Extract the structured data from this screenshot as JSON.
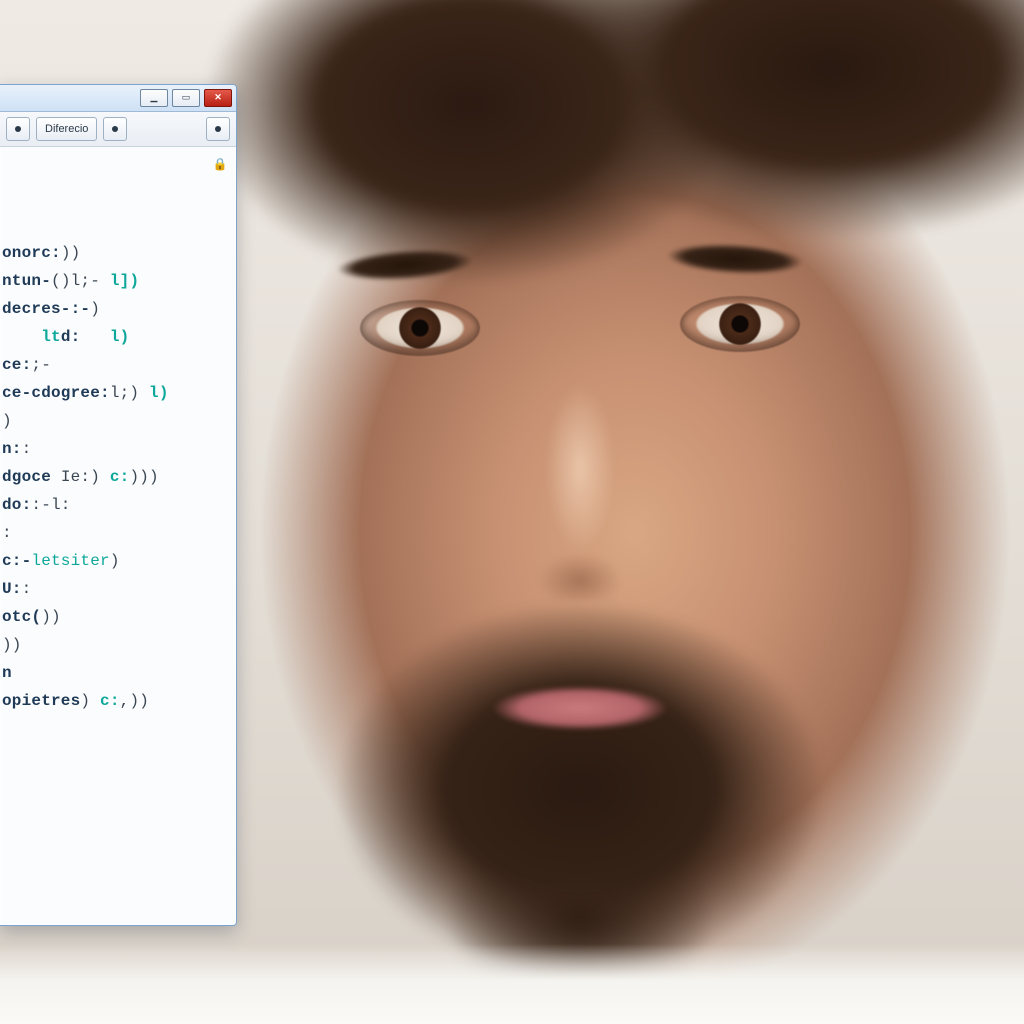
{
  "window": {
    "btn_min_glyph": "▁",
    "btn_max_glyph": "▭",
    "btn_close_glyph": "✕"
  },
  "toolbar": {
    "left_icon_glyph": "●",
    "tab_label": "Diferecio",
    "mid_icon_glyph": "●",
    "right_icon_glyph": "●"
  },
  "editor": {
    "lock_glyph": "🔒",
    "lines": [
      {
        "segments": [
          {
            "t": "onorc:",
            "c": "kw"
          },
          {
            "t": "))",
            "c": "punc"
          }
        ]
      },
      {
        "segments": [
          {
            "t": "ntun-",
            "c": "kw"
          },
          {
            "t": "()",
            "c": "punc"
          },
          {
            "t": "l;- ",
            "c": "punc"
          },
          {
            "t": "l])",
            "c": "tok-cyan"
          }
        ]
      },
      {
        "segments": [
          {
            "t": "decres-:-",
            "c": "kw"
          },
          {
            "t": ")",
            "c": "punc"
          }
        ]
      },
      {
        "segments": [
          {
            "t": "    lt",
            "c": "tok-cyan"
          },
          {
            "t": "d:   ",
            "c": "kw"
          },
          {
            "t": "l)",
            "c": "tok-cyan"
          }
        ]
      },
      {
        "segments": [
          {
            "t": "ce:",
            "c": "kw"
          },
          {
            "t": ";-",
            "c": "punc"
          }
        ]
      },
      {
        "segments": [
          {
            "t": "ce-cdogree:",
            "c": "kw"
          },
          {
            "t": "l;) ",
            "c": "punc"
          },
          {
            "t": "l)",
            "c": "tok-cyan"
          }
        ]
      },
      {
        "segments": [
          {
            "t": ")",
            "c": "punc"
          }
        ]
      },
      {
        "segments": [
          {
            "t": "",
            "c": "punc"
          }
        ]
      },
      {
        "segments": [
          {
            "t": "n:",
            "c": "kw"
          },
          {
            "t": ":",
            "c": "punc"
          }
        ]
      },
      {
        "segments": [
          {
            "t": "dgoce",
            "c": "kw"
          },
          {
            "t": " Ie:",
            "c": "punc"
          },
          {
            "t": ") ",
            "c": "punc"
          },
          {
            "t": "c:",
            "c": "tok-cyan"
          },
          {
            "t": ")))",
            "c": "punc"
          }
        ]
      },
      {
        "segments": [
          {
            "t": "do:",
            "c": "kw"
          },
          {
            "t": ":-l:",
            "c": "punc"
          }
        ]
      },
      {
        "segments": [
          {
            "t": ":",
            "c": "punc"
          }
        ]
      },
      {
        "segments": [
          {
            "t": "c:-",
            "c": "kw"
          },
          {
            "t": "letsiter",
            "c": "fn"
          },
          {
            "t": ")",
            "c": "punc"
          }
        ]
      },
      {
        "segments": [
          {
            "t": "U:",
            "c": "kw"
          },
          {
            "t": ":",
            "c": "punc"
          }
        ]
      },
      {
        "segments": [
          {
            "t": "otc(",
            "c": "kw"
          },
          {
            "t": "))",
            "c": "punc"
          }
        ]
      },
      {
        "segments": [
          {
            "t": "",
            "c": "punc"
          }
        ]
      },
      {
        "segments": [
          {
            "t": "))",
            "c": "punc"
          }
        ]
      },
      {
        "segments": [
          {
            "t": "n",
            "c": "kw"
          }
        ]
      },
      {
        "segments": [
          {
            "t": "",
            "c": "punc"
          }
        ]
      },
      {
        "segments": [
          {
            "t": "",
            "c": "punc"
          }
        ]
      },
      {
        "segments": [
          {
            "t": "opietres",
            "c": "kw"
          },
          {
            "t": ") ",
            "c": "punc"
          },
          {
            "t": "c:",
            "c": "tok-cyan"
          },
          {
            "t": ",))",
            "c": "punc"
          }
        ]
      }
    ]
  }
}
